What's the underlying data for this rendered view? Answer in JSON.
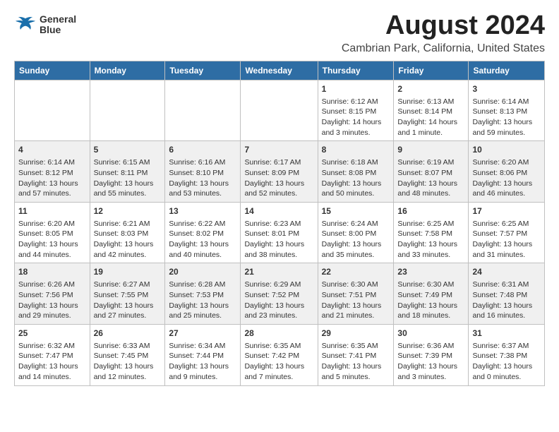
{
  "header": {
    "logo_line1": "General",
    "logo_line2": "Blue",
    "title": "August 2024",
    "subtitle": "Cambrian Park, California, United States"
  },
  "weekdays": [
    "Sunday",
    "Monday",
    "Tuesday",
    "Wednesday",
    "Thursday",
    "Friday",
    "Saturday"
  ],
  "weeks": [
    [
      {
        "day": "",
        "content": ""
      },
      {
        "day": "",
        "content": ""
      },
      {
        "day": "",
        "content": ""
      },
      {
        "day": "",
        "content": ""
      },
      {
        "day": "1",
        "content": "Sunrise: 6:12 AM\nSunset: 8:15 PM\nDaylight: 14 hours\nand 3 minutes."
      },
      {
        "day": "2",
        "content": "Sunrise: 6:13 AM\nSunset: 8:14 PM\nDaylight: 14 hours\nand 1 minute."
      },
      {
        "day": "3",
        "content": "Sunrise: 6:14 AM\nSunset: 8:13 PM\nDaylight: 13 hours\nand 59 minutes."
      }
    ],
    [
      {
        "day": "4",
        "content": "Sunrise: 6:14 AM\nSunset: 8:12 PM\nDaylight: 13 hours\nand 57 minutes."
      },
      {
        "day": "5",
        "content": "Sunrise: 6:15 AM\nSunset: 8:11 PM\nDaylight: 13 hours\nand 55 minutes."
      },
      {
        "day": "6",
        "content": "Sunrise: 6:16 AM\nSunset: 8:10 PM\nDaylight: 13 hours\nand 53 minutes."
      },
      {
        "day": "7",
        "content": "Sunrise: 6:17 AM\nSunset: 8:09 PM\nDaylight: 13 hours\nand 52 minutes."
      },
      {
        "day": "8",
        "content": "Sunrise: 6:18 AM\nSunset: 8:08 PM\nDaylight: 13 hours\nand 50 minutes."
      },
      {
        "day": "9",
        "content": "Sunrise: 6:19 AM\nSunset: 8:07 PM\nDaylight: 13 hours\nand 48 minutes."
      },
      {
        "day": "10",
        "content": "Sunrise: 6:20 AM\nSunset: 8:06 PM\nDaylight: 13 hours\nand 46 minutes."
      }
    ],
    [
      {
        "day": "11",
        "content": "Sunrise: 6:20 AM\nSunset: 8:05 PM\nDaylight: 13 hours\nand 44 minutes."
      },
      {
        "day": "12",
        "content": "Sunrise: 6:21 AM\nSunset: 8:03 PM\nDaylight: 13 hours\nand 42 minutes."
      },
      {
        "day": "13",
        "content": "Sunrise: 6:22 AM\nSunset: 8:02 PM\nDaylight: 13 hours\nand 40 minutes."
      },
      {
        "day": "14",
        "content": "Sunrise: 6:23 AM\nSunset: 8:01 PM\nDaylight: 13 hours\nand 38 minutes."
      },
      {
        "day": "15",
        "content": "Sunrise: 6:24 AM\nSunset: 8:00 PM\nDaylight: 13 hours\nand 35 minutes."
      },
      {
        "day": "16",
        "content": "Sunrise: 6:25 AM\nSunset: 7:58 PM\nDaylight: 13 hours\nand 33 minutes."
      },
      {
        "day": "17",
        "content": "Sunrise: 6:25 AM\nSunset: 7:57 PM\nDaylight: 13 hours\nand 31 minutes."
      }
    ],
    [
      {
        "day": "18",
        "content": "Sunrise: 6:26 AM\nSunset: 7:56 PM\nDaylight: 13 hours\nand 29 minutes."
      },
      {
        "day": "19",
        "content": "Sunrise: 6:27 AM\nSunset: 7:55 PM\nDaylight: 13 hours\nand 27 minutes."
      },
      {
        "day": "20",
        "content": "Sunrise: 6:28 AM\nSunset: 7:53 PM\nDaylight: 13 hours\nand 25 minutes."
      },
      {
        "day": "21",
        "content": "Sunrise: 6:29 AM\nSunset: 7:52 PM\nDaylight: 13 hours\nand 23 minutes."
      },
      {
        "day": "22",
        "content": "Sunrise: 6:30 AM\nSunset: 7:51 PM\nDaylight: 13 hours\nand 21 minutes."
      },
      {
        "day": "23",
        "content": "Sunrise: 6:30 AM\nSunset: 7:49 PM\nDaylight: 13 hours\nand 18 minutes."
      },
      {
        "day": "24",
        "content": "Sunrise: 6:31 AM\nSunset: 7:48 PM\nDaylight: 13 hours\nand 16 minutes."
      }
    ],
    [
      {
        "day": "25",
        "content": "Sunrise: 6:32 AM\nSunset: 7:47 PM\nDaylight: 13 hours\nand 14 minutes."
      },
      {
        "day": "26",
        "content": "Sunrise: 6:33 AM\nSunset: 7:45 PM\nDaylight: 13 hours\nand 12 minutes."
      },
      {
        "day": "27",
        "content": "Sunrise: 6:34 AM\nSunset: 7:44 PM\nDaylight: 13 hours\nand 9 minutes."
      },
      {
        "day": "28",
        "content": "Sunrise: 6:35 AM\nSunset: 7:42 PM\nDaylight: 13 hours\nand 7 minutes."
      },
      {
        "day": "29",
        "content": "Sunrise: 6:35 AM\nSunset: 7:41 PM\nDaylight: 13 hours\nand 5 minutes."
      },
      {
        "day": "30",
        "content": "Sunrise: 6:36 AM\nSunset: 7:39 PM\nDaylight: 13 hours\nand 3 minutes."
      },
      {
        "day": "31",
        "content": "Sunrise: 6:37 AM\nSunset: 7:38 PM\nDaylight: 13 hours\nand 0 minutes."
      }
    ]
  ]
}
